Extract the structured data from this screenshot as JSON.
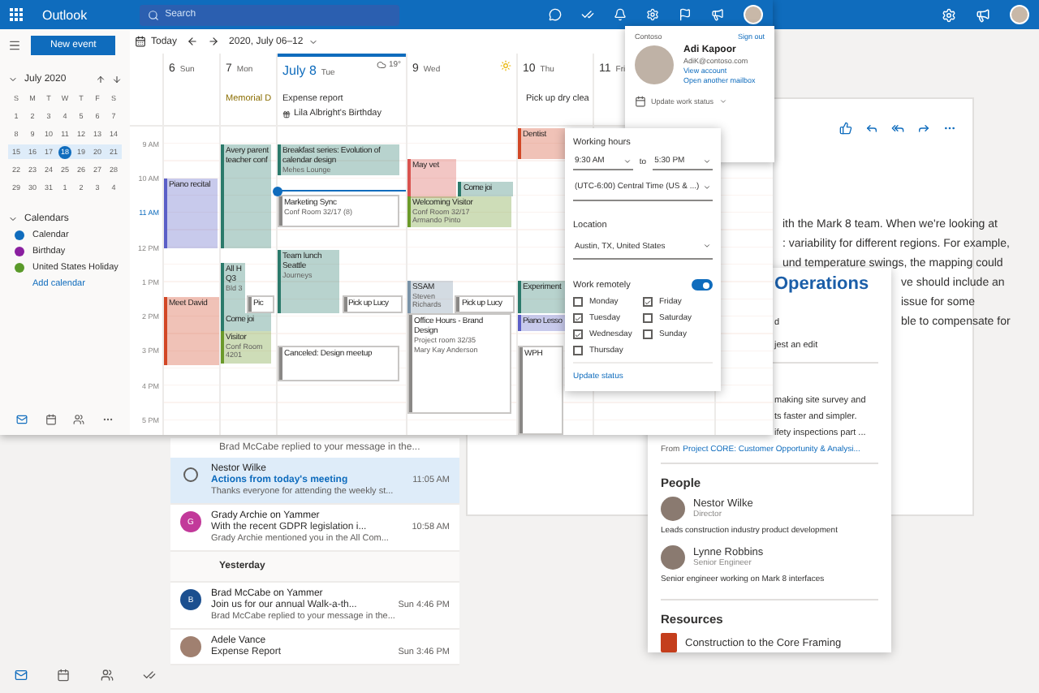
{
  "mail_window": {
    "message_list": [
      {
        "kind": "fragment",
        "preview": "Brad McCabe replied to your message in the..."
      },
      {
        "kind": "message",
        "selected": true,
        "unread": true,
        "avatar": {
          "kind": "radio"
        },
        "sender": "Nestor Wilke",
        "subject": "Actions from today's meeting",
        "time": "11:05 AM",
        "preview": "Thanks everyone for attending the weekly st..."
      },
      {
        "kind": "message",
        "selected": false,
        "unread": false,
        "avatar": {
          "kind": "initial",
          "letter": "G",
          "color": "#c2399a"
        },
        "sender": "Grady Archie on Yammer",
        "subject": "With the recent GDPR legislation i...",
        "time": "10:58 AM",
        "preview": "Grady Archie mentioned you in the All Com..."
      },
      {
        "kind": "header",
        "label": "Yesterday"
      },
      {
        "kind": "message",
        "selected": false,
        "unread": false,
        "avatar": {
          "kind": "initial",
          "letter": "B",
          "color": "#1b4f8f"
        },
        "sender": "Brad McCabe on Yammer",
        "subject": "Join us for our annual Walk-a-th...",
        "time": "Sun 4:46 PM",
        "preview": "Brad McCabe replied to your message in the..."
      },
      {
        "kind": "message",
        "selected": false,
        "unread": false,
        "avatar": {
          "kind": "photo"
        },
        "sender": "Adele Vance",
        "subject": "Expense Report",
        "time": "Sun 3:46 PM"
      }
    ],
    "reading_pane": {
      "lines": [
        {
          "kind": "open",
          "text": "ith the Mark 8 team. When we're looking at"
        },
        {
          "kind": "open",
          "text": ": variability for different regions. For example,"
        },
        {
          "kind": "open",
          "text": "und temperature swings, the mapping could"
        },
        {
          "kind": "beside_card",
          "text": "ve should include an"
        },
        {
          "kind": "beside_card",
          "text": "issue for some"
        },
        {
          "kind": "beside_card",
          "text": "ble to compensate for"
        }
      ]
    },
    "topic_card": {
      "title": "Operations",
      "lines": [
        "d",
        "jest an edit"
      ],
      "summary": [
        "making site survey and",
        "ts faster and simpler.",
        "ifety inspections part ..."
      ],
      "source_prefix": "From",
      "source_link": "Project CORE: Customer Opportunity & Analysi...",
      "people_heading": "People",
      "people": [
        {
          "name": "Nestor Wilke",
          "role": "Director",
          "note": "Leads construction industry product development"
        },
        {
          "name": "Lynne Robbins",
          "role": "Senior Engineer",
          "note": "Senior engineer working on Mark 8 interfaces"
        }
      ],
      "resources_heading": "Resources",
      "resources": [
        "Construction to the Core Framing"
      ]
    }
  },
  "calendar_window": {
    "app_name": "Outlook",
    "search": {
      "placeholder": "Search"
    },
    "new_event": "New event",
    "mini_calendar": {
      "month": "July 2020",
      "weekdays": [
        "S",
        "M",
        "T",
        "W",
        "T",
        "F",
        "S"
      ],
      "weeks": [
        {
          "current": false,
          "days": [
            {
              "day": "1",
              "selected": false
            },
            {
              "day": "2",
              "selected": false
            },
            {
              "day": "3",
              "selected": false
            },
            {
              "day": "4",
              "selected": false
            },
            {
              "day": "5",
              "selected": false
            },
            {
              "day": "6",
              "selected": false
            },
            {
              "day": "7",
              "selected": false
            }
          ]
        },
        {
          "current": false,
          "days": [
            {
              "day": "8",
              "selected": false
            },
            {
              "day": "9",
              "selected": false
            },
            {
              "day": "10",
              "selected": false
            },
            {
              "day": "11",
              "selected": false
            },
            {
              "day": "12",
              "selected": false
            },
            {
              "day": "13",
              "selected": false
            },
            {
              "day": "14",
              "selected": false
            }
          ]
        },
        {
          "current": true,
          "days": [
            {
              "day": "15",
              "selected": false
            },
            {
              "day": "16",
              "selected": false
            },
            {
              "day": "17",
              "selected": false
            },
            {
              "day": "18",
              "selected": true
            },
            {
              "day": "19",
              "selected": false
            },
            {
              "day": "20",
              "selected": false
            },
            {
              "day": "21",
              "selected": false
            }
          ]
        },
        {
          "current": false,
          "days": [
            {
              "day": "22",
              "selected": false
            },
            {
              "day": "23",
              "selected": false
            },
            {
              "day": "24",
              "selected": false
            },
            {
              "day": "25",
              "selected": false
            },
            {
              "day": "26",
              "selected": false
            },
            {
              "day": "27",
              "selected": false
            },
            {
              "day": "28",
              "selected": false
            }
          ]
        },
        {
          "current": false,
          "days": [
            {
              "day": "29",
              "selected": false
            },
            {
              "day": "30",
              "selected": false
            },
            {
              "day": "31",
              "selected": false
            },
            {
              "day": "1",
              "selected": false
            },
            {
              "day": "2",
              "selected": false
            },
            {
              "day": "3",
              "selected": false
            },
            {
              "day": "4",
              "selected": false
            }
          ]
        }
      ]
    },
    "calendars_heading": "Calendars",
    "calendars": [
      {
        "name": "Calendar",
        "color": "#0f6cbd"
      },
      {
        "name": "Birthday",
        "color": "#8a1fa0"
      },
      {
        "name": "United States Holiday",
        "color": "#5a9a2a"
      }
    ],
    "add_calendar": "Add calendar",
    "toolbar": {
      "today": "Today",
      "range": "2020, July 06–12"
    },
    "hours": [
      {
        "label": "9 AM",
        "current": false
      },
      {
        "label": "10 AM",
        "current": false
      },
      {
        "label": "11 AM",
        "current": true
      },
      {
        "label": "12 PM",
        "current": false
      },
      {
        "label": "1 PM",
        "current": false
      },
      {
        "label": "2 PM",
        "current": false
      },
      {
        "label": "3 PM",
        "current": false
      },
      {
        "label": "4 PM",
        "current": false
      },
      {
        "label": "5 PM",
        "current": false
      }
    ],
    "days": [
      {
        "number": "6",
        "name": "Sun",
        "selected": false,
        "events": [
          {
            "kind": "filled",
            "color": "#5b5fc7",
            "title": "Piano recital"
          },
          {
            "kind": "filled",
            "color": "#d24726",
            "title": "Meet David"
          }
        ]
      },
      {
        "number": "7",
        "name": "Mon",
        "selected": false,
        "all_day": [
          {
            "kind": "holiday",
            "title": "Memorial D"
          }
        ],
        "events": [
          {
            "kind": "filled",
            "color": "#2b7a6b",
            "title": "Avery parent teacher conf"
          },
          {
            "kind": "filled",
            "color": "#2b7a6b",
            "title": "All H Q3",
            "details": [
              "Bld 3"
            ]
          },
          {
            "kind": "outline",
            "color": "#8a8886",
            "title": "Pic"
          },
          {
            "kind": "filled",
            "color": "#2b7a6b",
            "title": "Come joi"
          },
          {
            "kind": "filled",
            "color": "#6b9a2a",
            "title": "Visitor",
            "details": [
              "Conf Room",
              "4201"
            ]
          }
        ]
      },
      {
        "number": "July 8",
        "name": "Tue",
        "selected": true,
        "weather": {
          "kind": "cloud",
          "temp": "19°"
        },
        "all_day": [
          {
            "kind": "plain",
            "title": "Expense report"
          },
          {
            "kind": "birthday",
            "title": "Lila Albright's Birthday"
          }
        ],
        "events": [
          {
            "kind": "filled",
            "color": "#2b7a6b",
            "title": "Breakfast series: Evolution of calendar design",
            "details": [
              "Mehes Lounge"
            ]
          },
          {
            "kind": "outline",
            "color": "#8a8886",
            "title": "Marketing Sync",
            "details": [
              "Conf Room 32/17 (8)"
            ]
          },
          {
            "kind": "filled",
            "color": "#2b7a6b",
            "title": "Team lunch Seattle",
            "details": [
              "Journeys"
            ]
          },
          {
            "kind": "outline",
            "color": "#8a8886",
            "title": "Pick up Lucy"
          },
          {
            "kind": "outline",
            "color": "#8a8886",
            "title": "Canceled: Design meetup"
          }
        ]
      },
      {
        "number": "9",
        "name": "Wed",
        "selected": false,
        "weather": {
          "kind": "sun"
        },
        "events": [
          {
            "kind": "filled",
            "color": "#d9534f",
            "title": "May vet"
          },
          {
            "kind": "filled",
            "color": "#2b7a6b",
            "title": "Come joi"
          },
          {
            "kind": "filled",
            "color": "#6b9a2a",
            "title": "Welcoming Visitor",
            "details": [
              "Conf Room 32/17",
              "Armando Pinto"
            ]
          },
          {
            "kind": "filled",
            "color": "#7a93a8",
            "title": "SSAM",
            "details": [
              "Steven Richards"
            ]
          },
          {
            "kind": "outline",
            "color": "#8a8886",
            "title": "Pick up Lucy"
          },
          {
            "kind": "outline",
            "color": "#8a8886",
            "title": "Office Hours - Brand Design",
            "details": [
              "Project room 32/35",
              "Mary Kay Anderson"
            ]
          }
        ]
      },
      {
        "number": "10",
        "name": "Thu",
        "selected": false,
        "all_day": [
          {
            "kind": "task",
            "title": "Pick up dry clea"
          }
        ],
        "events": [
          {
            "kind": "filled",
            "color": "#d24726",
            "title": "Dentist"
          },
          {
            "kind": "filled",
            "color": "#2b7a6b",
            "title": "Experiment"
          },
          {
            "kind": "filled",
            "color": "#5b5fc7",
            "title": "Piano Lesso"
          },
          {
            "kind": "outline",
            "color": "#8a8886",
            "title": "WPH"
          }
        ]
      },
      {
        "number": "11",
        "name": "Fri",
        "selected": false
      }
    ]
  },
  "profile_popup": {
    "org": "Contoso",
    "sign_out": "Sign out",
    "name": "Adi Kapoor",
    "email": "AdiK@contoso.com",
    "view_account": "View account",
    "other_mailbox": "Open another mailbox",
    "status_menu": "Update work status"
  },
  "work_status_popup": {
    "working_hours_label": "Working hours",
    "from": "9:30 AM",
    "to_label": "to",
    "to": "5:30 PM",
    "timezone": "(UTC-6:00) Central Time (US & ...)",
    "location_label": "Location",
    "location": "Austin, TX, United States",
    "remote_label": "Work remotely",
    "remote_on": true,
    "days": [
      {
        "label": "Monday",
        "checked": false
      },
      {
        "label": "Friday",
        "checked": true
      },
      {
        "label": "Tuesday",
        "checked": true
      },
      {
        "label": "Saturday",
        "checked": false
      },
      {
        "label": "Wednesday",
        "checked": true
      },
      {
        "label": "Sunday",
        "checked": false
      },
      {
        "label": "Thursday",
        "checked": false
      }
    ],
    "update_link": "Update status"
  }
}
